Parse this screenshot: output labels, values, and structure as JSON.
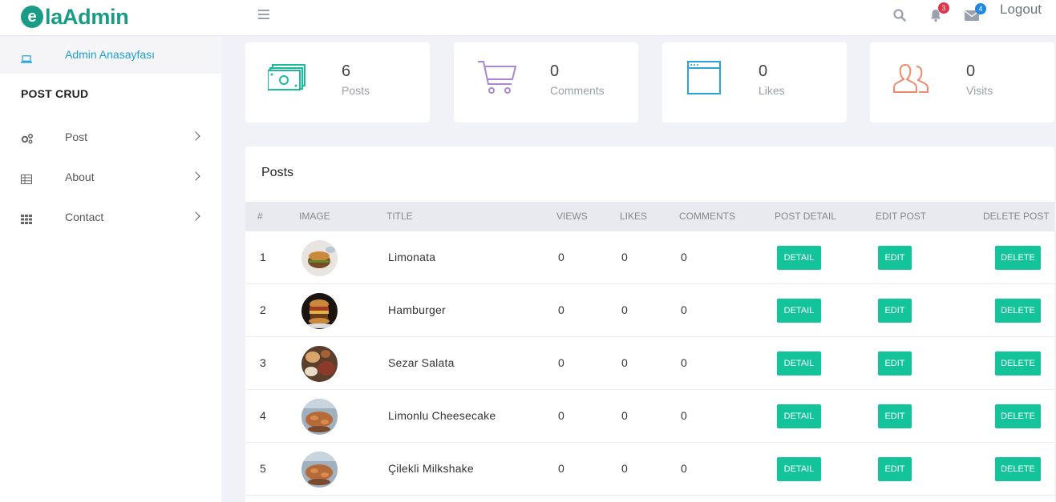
{
  "brand": {
    "letter": "e",
    "part1": "la",
    "part2": "Admin"
  },
  "header": {
    "notifications_count": "3",
    "messages_count": "4",
    "logout_label": "Logout",
    "icons": {
      "menu": "hamburger-icon",
      "search": "search-icon",
      "bell": "bell-icon",
      "mail": "envelope-icon"
    }
  },
  "sidebar": {
    "active_item": {
      "label": "Admin Anasayfası",
      "icon": "laptop-icon"
    },
    "section_title": "POST CRUD",
    "items": [
      {
        "label": "Post",
        "icon": "cogs-icon"
      },
      {
        "label": "About",
        "icon": "table-icon"
      },
      {
        "label": "Contact",
        "icon": "grid-icon"
      }
    ]
  },
  "stats": [
    {
      "value": "6",
      "label": "Posts",
      "icon": "money-icon",
      "color": "#1abc9c"
    },
    {
      "value": "0",
      "label": "Comments",
      "icon": "cart-icon",
      "color": "#a887d8"
    },
    {
      "value": "0",
      "label": "Likes",
      "icon": "browser-window-icon",
      "color": "#2aa3d9"
    },
    {
      "value": "0",
      "label": "Visits",
      "icon": "users-icon",
      "color": "#f08a6c"
    }
  ],
  "posts_table": {
    "title": "Posts",
    "headers": [
      "#",
      "IMAGE",
      "TITLE",
      "VIEWS",
      "LIKES",
      "COMMENTS",
      "POST DETAIL",
      "EDIT POST",
      "DELETE POST"
    ],
    "buttons": {
      "detail": "DETAIL",
      "edit": "EDIT",
      "delete": "DELETE"
    },
    "rows": [
      {
        "num": "1",
        "title": "Limonata",
        "views": "0",
        "likes": "0",
        "comments": "0"
      },
      {
        "num": "2",
        "title": "Hamburger",
        "views": "0",
        "likes": "0",
        "comments": "0"
      },
      {
        "num": "3",
        "title": "Sezar Salata",
        "views": "0",
        "likes": "0",
        "comments": "0"
      },
      {
        "num": "4",
        "title": "Limonlu Cheesecake",
        "views": "0",
        "likes": "0",
        "comments": "0"
      },
      {
        "num": "5",
        "title": "Çilekli Milkshake",
        "views": "0",
        "likes": "0",
        "comments": "0"
      }
    ]
  },
  "colors": {
    "accent": "#13c39a",
    "link": "#1e9ed8",
    "brand": "#1a9b86"
  }
}
